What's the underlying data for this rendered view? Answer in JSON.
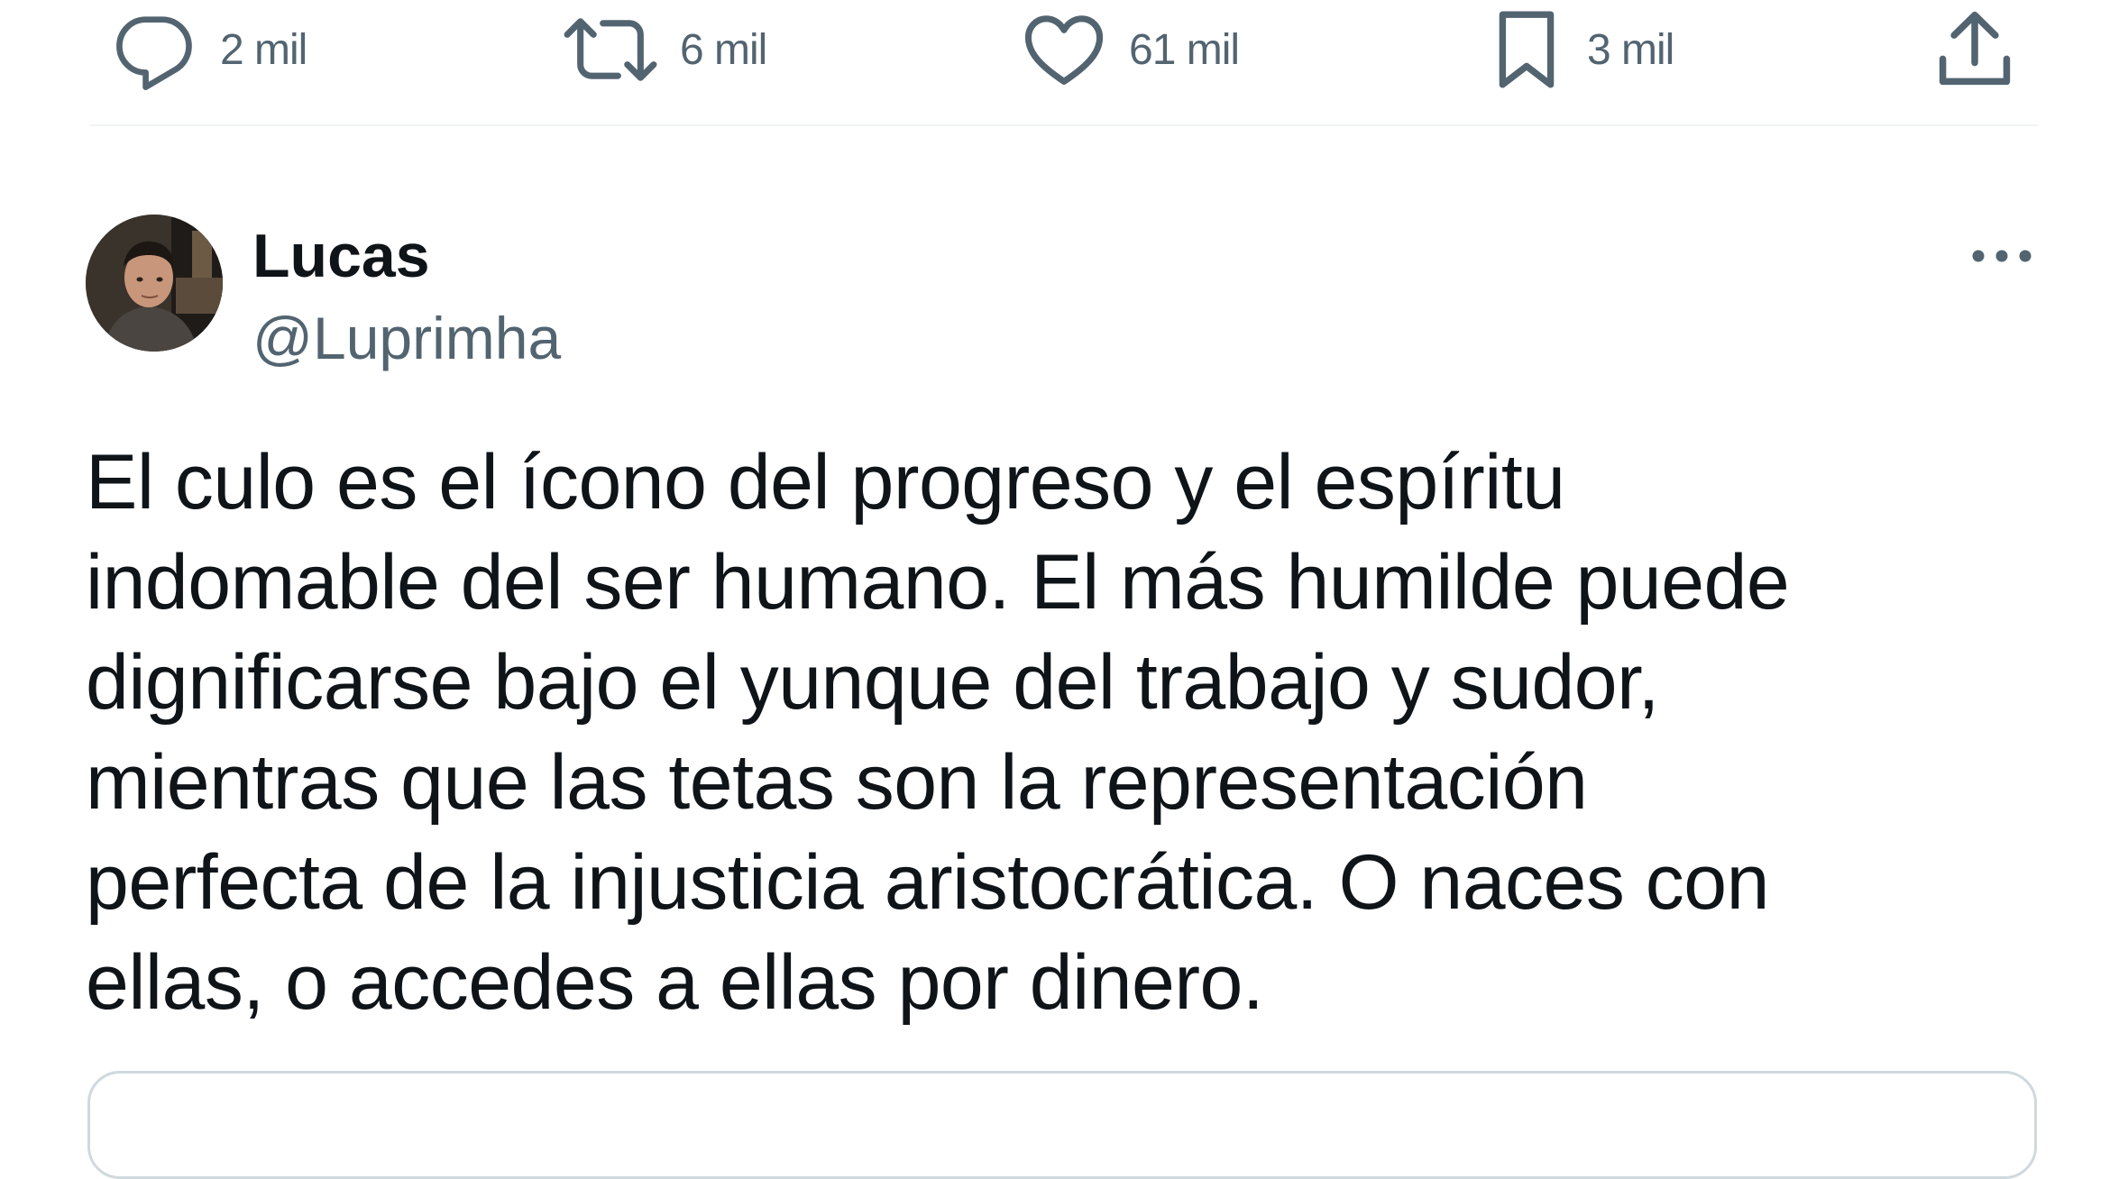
{
  "actions": {
    "reply": {
      "icon": "reply-icon",
      "count": "2 mil"
    },
    "retweet": {
      "icon": "retweet-icon",
      "count": "6 mil"
    },
    "like": {
      "icon": "heart-icon",
      "count": "61 mil"
    },
    "bookmark": {
      "icon": "bookmark-icon",
      "count": "3 mil"
    },
    "share": {
      "icon": "share-icon"
    }
  },
  "tweet": {
    "author": {
      "name": "Lucas",
      "handle": "@Luprimha"
    },
    "more_icon": "more-horizontal-icon",
    "text_lines": [
      "El culo es el ícono del progreso y el espíritu",
      "indomable del ser humano. El más humilde puede",
      "dignificarse bajo el yunque del trabajo y sudor,",
      "mientras que las tetas son la representación",
      "perfecta de la injusticia aristocrática. O naces con",
      "ellas, o accedes a ellas por dinero."
    ]
  },
  "colors": {
    "text_primary": "#0f1419",
    "text_secondary": "#536471",
    "divider": "#eff3f4",
    "card_border": "#cfd9de"
  }
}
